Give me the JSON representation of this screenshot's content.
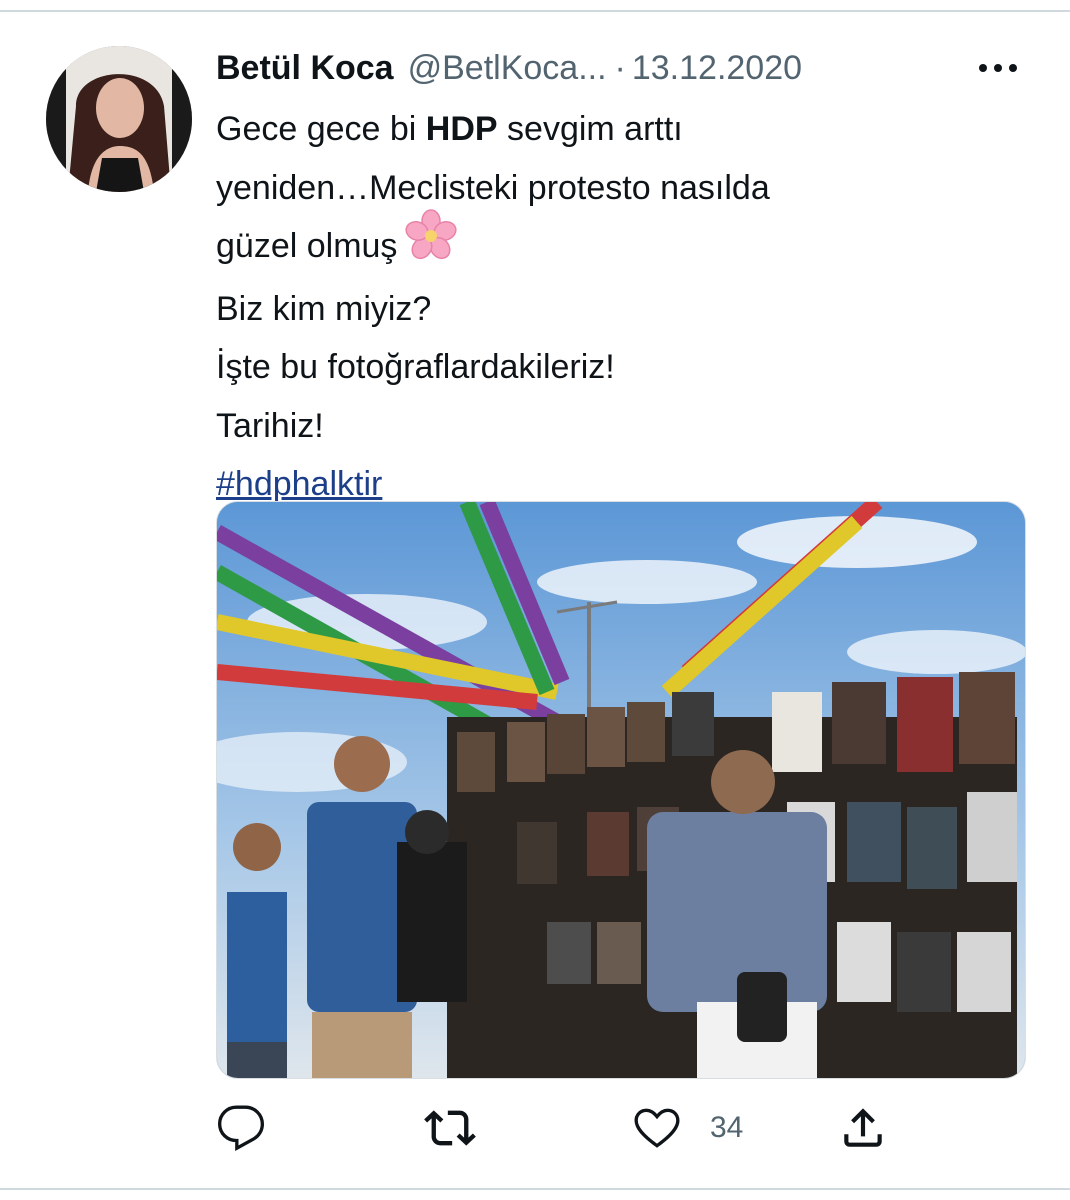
{
  "tweet": {
    "author_name": "Betül Koca",
    "author_handle": "@BetlKoca...",
    "separator": "·",
    "date": "13.12.2020",
    "more_label": "•••",
    "text_lines": [
      {
        "before": "Gece gece bi ",
        "bold": "HDP",
        "after": " sevgim arttı"
      },
      "yeniden…Meclisteki protesto nasılda",
      "güzel olmuş",
      "Biz kim miyiz?",
      "İşte bu fotoğraflardakileriz!",
      "Tarihiz!"
    ],
    "hashtag": "#hdphalktir",
    "emoji": "cherry-blossom"
  },
  "actions": {
    "reply": {
      "icon": "reply-icon",
      "count": ""
    },
    "retweet": {
      "icon": "retweet-icon",
      "count": ""
    },
    "like": {
      "icon": "heart-icon",
      "count": "34"
    },
    "share": {
      "icon": "share-icon",
      "count": ""
    }
  },
  "colors": {
    "text": "#0f1419",
    "secondary": "#536471",
    "link": "#1d3f8a",
    "divider": "#cfd9de"
  }
}
